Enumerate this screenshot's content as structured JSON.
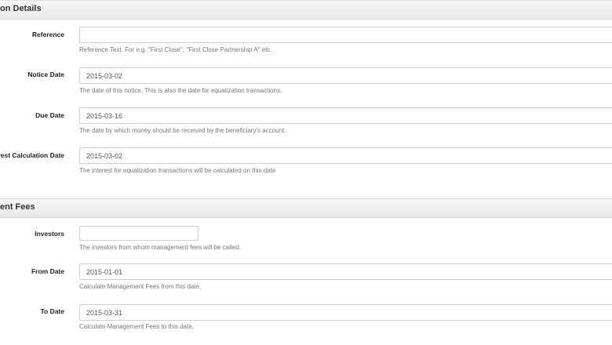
{
  "sections": [
    {
      "title": "on Details"
    },
    {
      "title": "ent Fees"
    }
  ],
  "fields": {
    "reference": {
      "label": "Reference",
      "value": "",
      "help": "Reference Text. For e.g. \"First Close\", \"First Close Partnership A\" etc."
    },
    "notice_date": {
      "label": "Notice Date",
      "value": "2015-03-02",
      "help": "The date of this notice. This is also the date for equalization transactions."
    },
    "due_date": {
      "label": "Due Date",
      "value": "2015-03-16",
      "help": "The date by which money should be received by the beneficiary's account."
    },
    "interest_date": {
      "label": "erest Calculation Date",
      "value": "2015-03-02",
      "help": "The interest for equalization transactions will be calculated on this date"
    },
    "investors": {
      "label": "Investors",
      "value": "",
      "help": "The investors from whom management fees will be called."
    },
    "from_date": {
      "label": "From Date",
      "value": "2015-01-01",
      "help": "Calculate Management Fees from this date."
    },
    "to_date": {
      "label": "To Date",
      "value": "2015-03-31",
      "help": "Calculate Management Fees to this date."
    }
  }
}
